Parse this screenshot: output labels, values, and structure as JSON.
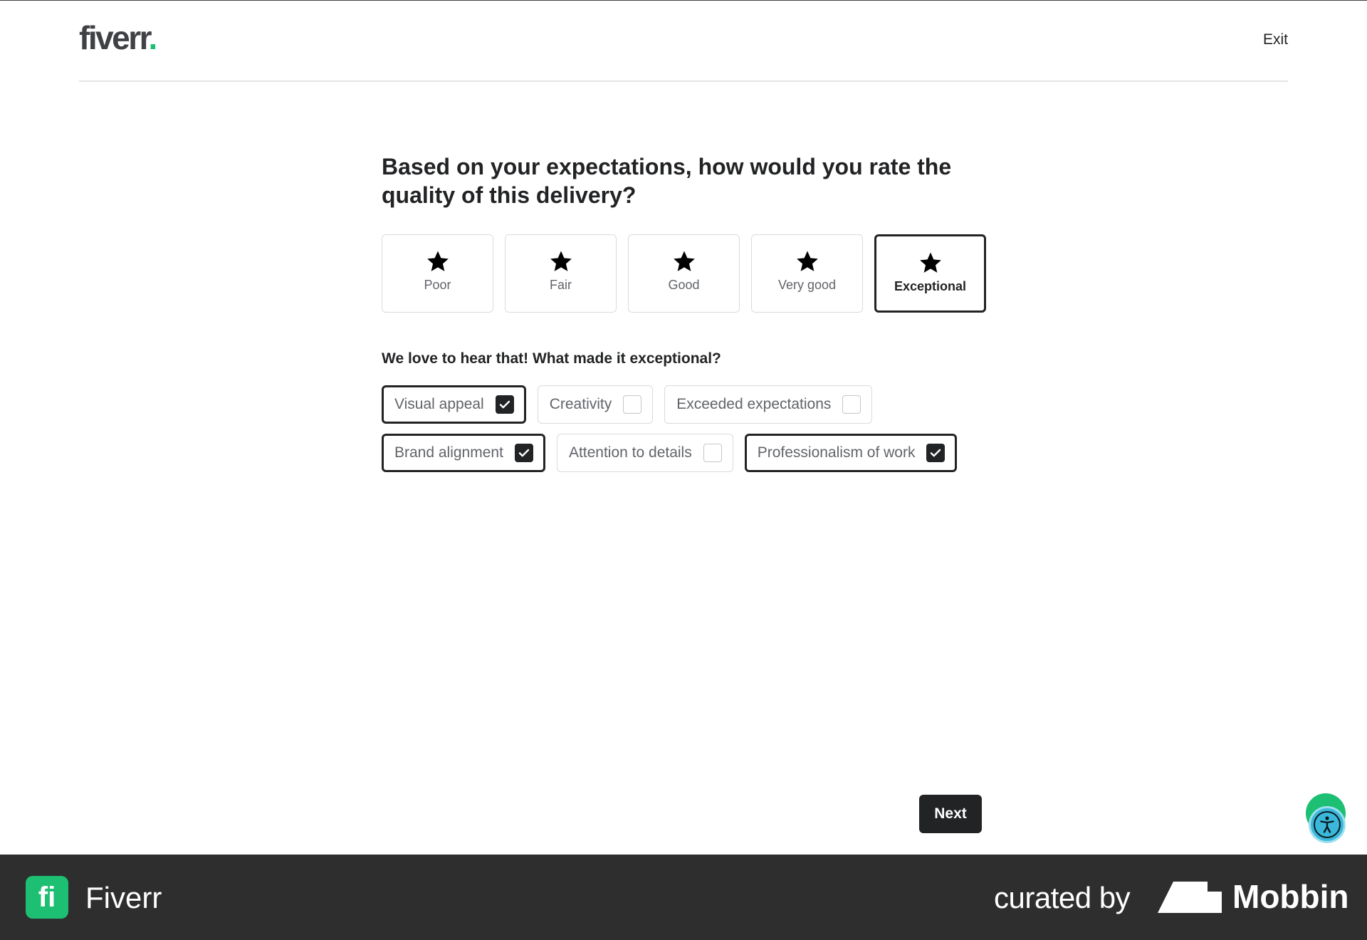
{
  "header": {
    "logo_text": "fiverr",
    "logo_dot": ".",
    "exit_label": "Exit"
  },
  "question": "Based on your expectations, how would you rate the quality of this delivery?",
  "ratings": [
    {
      "label": "Poor",
      "selected": false
    },
    {
      "label": "Fair",
      "selected": false
    },
    {
      "label": "Good",
      "selected": false
    },
    {
      "label": "Very good",
      "selected": false
    },
    {
      "label": "Exceptional",
      "selected": true
    }
  ],
  "followup_question": "We love to hear that! What made it exceptional?",
  "reasons": [
    {
      "label": "Visual appeal",
      "checked": true
    },
    {
      "label": "Creativity",
      "checked": false
    },
    {
      "label": "Exceeded expectations",
      "checked": false
    },
    {
      "label": "Brand alignment",
      "checked": true
    },
    {
      "label": "Attention to details",
      "checked": false
    },
    {
      "label": "Professionalism of work",
      "checked": true
    }
  ],
  "next_label": "Next",
  "footer": {
    "app_icon_letter": "fi",
    "app_name": "Fiverr",
    "curated_by": "curated by",
    "brand": "Mobbin"
  },
  "colors": {
    "accent": "#1dbf73",
    "text": "#222325",
    "footer_bg": "#2e2e2e"
  },
  "icons": [
    "star-icon",
    "checkmark-icon",
    "accessibility-icon",
    "mobbin-logo-icon"
  ]
}
